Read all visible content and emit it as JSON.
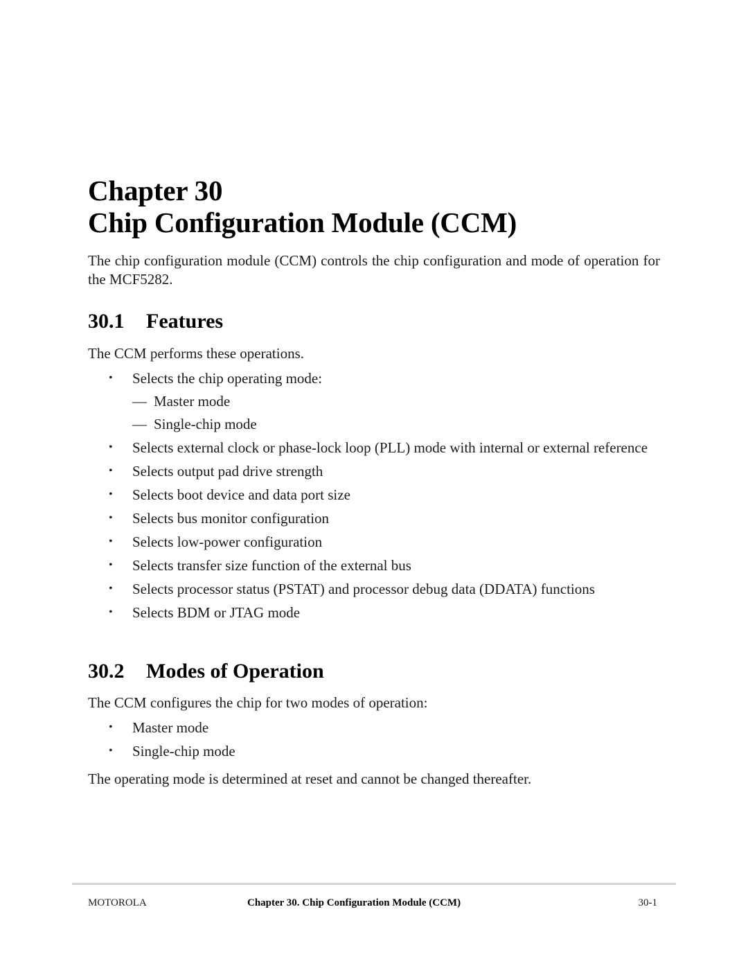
{
  "chapter": {
    "line1": "Chapter 30",
    "line2": "Chip Configuration Module (CCM)"
  },
  "intro": "The chip configuration module (CCM) controls the chip configuration and mode of operation for the MCF5282.",
  "sections": [
    {
      "number": "30.1",
      "title": "Features",
      "lead": "The CCM performs these operations.",
      "bullet_glyph": "•",
      "dash_glyph": "—",
      "items": [
        {
          "text": "Selects the chip operating mode:",
          "subitems": [
            "Master mode",
            "Single-chip mode"
          ]
        },
        {
          "text": "Selects external clock or phase-lock loop (PLL) mode with internal or external reference"
        },
        {
          "text": "Selects output pad drive strength"
        },
        {
          "text": "Selects boot device and data port size"
        },
        {
          "text": "Selects bus monitor configuration"
        },
        {
          "text": "Selects low-power configuration"
        },
        {
          "text": "Selects transfer size function of the external bus"
        },
        {
          "text": "Selects processor status (PSTAT) and processor debug data (DDATA) functions"
        },
        {
          "text": "Selects BDM or JTAG mode"
        }
      ]
    },
    {
      "number": "30.2",
      "title": "Modes of Operation",
      "lead": "The CCM configures the chip for two modes of operation:",
      "bullet_glyph": "•",
      "items": [
        {
          "text": "Master mode"
        },
        {
          "text": "Single-chip mode"
        }
      ],
      "closing": "The operating mode is determined at reset and cannot be changed thereafter."
    }
  ],
  "footer": {
    "left": "MOTOROLA",
    "center": "Chapter 30.  Chip Configuration Module (CCM)",
    "right": "30-1"
  }
}
